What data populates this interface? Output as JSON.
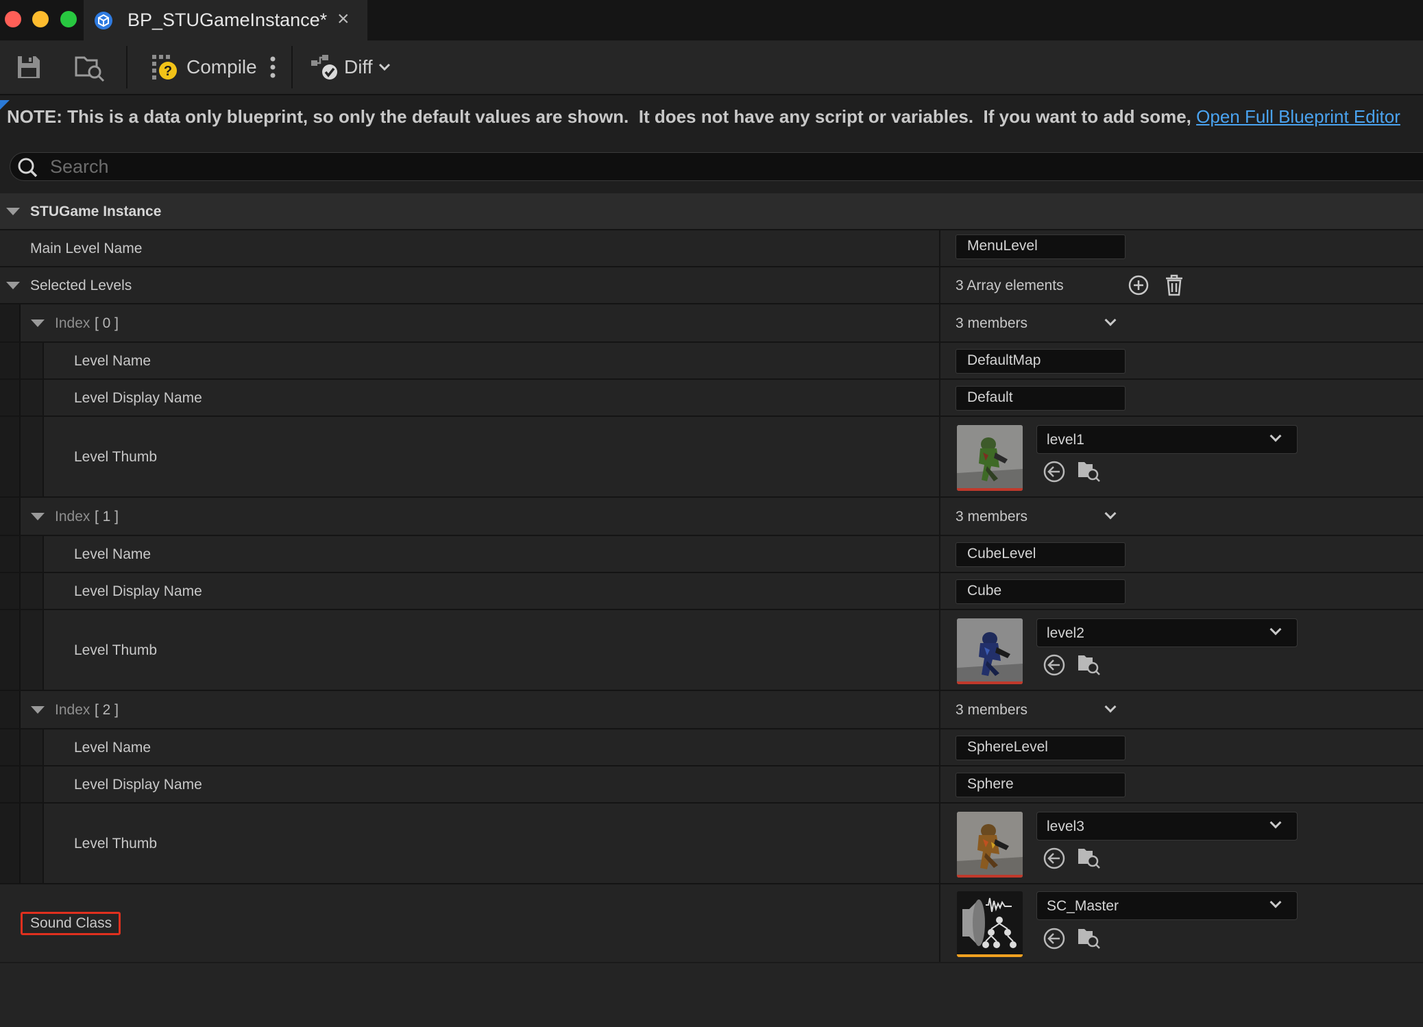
{
  "window": {
    "tab_title": "BP_STUGameInstance*",
    "close_glyph": "×"
  },
  "toolbar": {
    "compile_label": "Compile",
    "diff_label": "Diff"
  },
  "note": {
    "text": "NOTE: This is a data only blueprint, so only the default values are shown.  It does not have any script or variables.  If you want to add some, ",
    "link_text": "Open Full Blueprint Editor"
  },
  "search": {
    "placeholder": "Search"
  },
  "details": {
    "category_title": "STUGame Instance",
    "main_level_name_label": "Main Level Name",
    "main_level_name_value": "MenuLevel",
    "selected_levels_label": "Selected Levels",
    "selected_levels_count": "3 Array elements",
    "levels": [
      {
        "index_label": "Index",
        "index_num": "[ 0 ]",
        "members": "3 members",
        "level_name_label": "Level Name",
        "level_name_value": "DefaultMap",
        "display_name_label": "Level Display Name",
        "display_name_value": "Default",
        "thumb_label": "Level Thumb",
        "thumb_asset": "level1"
      },
      {
        "index_label": "Index",
        "index_num": "[ 1 ]",
        "members": "3 members",
        "level_name_label": "Level Name",
        "level_name_value": "CubeLevel",
        "display_name_label": "Level Display Name",
        "display_name_value": "Cube",
        "thumb_label": "Level Thumb",
        "thumb_asset": "level2"
      },
      {
        "index_label": "Index",
        "index_num": "[ 2 ]",
        "members": "3 members",
        "level_name_label": "Level Name",
        "level_name_value": "SphereLevel",
        "display_name_label": "Level Display Name",
        "display_name_value": "Sphere",
        "thumb_label": "Level Thumb",
        "thumb_asset": "level3"
      }
    ],
    "sound_class_label": "Sound Class",
    "sound_class_value": "SC_Master"
  },
  "colors": {
    "link": "#4aa3f0",
    "texture_thumb_bar": "#c0392b",
    "sound_thumb_bar": "#f0a020",
    "highlight_box": "#e0301e"
  },
  "icons": [
    "save-icon",
    "browse-icon",
    "compile-icon",
    "diff-icon",
    "search-icon",
    "add-element-icon",
    "delete-all-icon",
    "use-selected-icon",
    "browse-asset-icon"
  ]
}
